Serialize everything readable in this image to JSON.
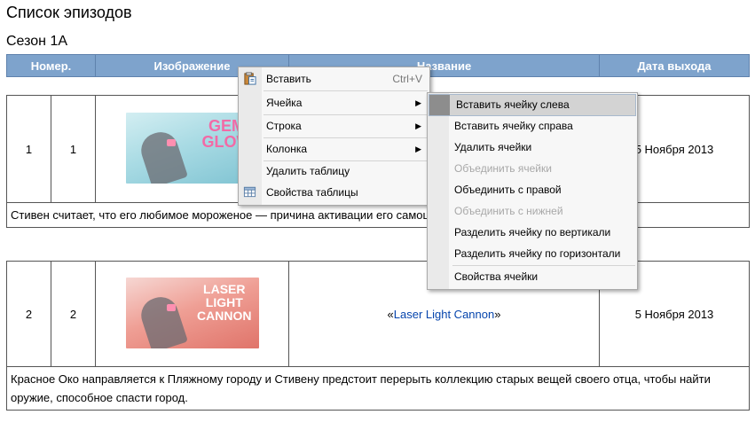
{
  "page": {
    "title": "Список эпизодов",
    "season": "Сезон 1А"
  },
  "table_header": {
    "columns": [
      "Номер.",
      "Изображение",
      "Название",
      "Дата выхода"
    ]
  },
  "episodes": [
    {
      "num_overall": "1",
      "num_season": "1",
      "thumb_title": "GEM GLOW",
      "date": "5 Ноября 2013",
      "description": "Стивен считает, что его любимое мороженое — причина активации его самоц"
    },
    {
      "num_overall": "2",
      "num_season": "2",
      "thumb_title": "LASER LIGHT CANNON",
      "title_prefix": "«",
      "title_link": "Laser Light Cannon",
      "title_suffix": "»",
      "date": "5 Ноября 2013",
      "description": "Красное Око направляется к Пляжному городу и Стивену предстоит перерыть коллекцию старых вещей своего отца, чтобы найти оружие, способное спасти город."
    }
  ],
  "context_menu": {
    "items": [
      {
        "label": "Вставить",
        "shortcut": "Ctrl+V",
        "icon": "paste-icon"
      },
      {
        "label": "Ячейка",
        "submenu": true
      },
      {
        "label": "Строка",
        "submenu": true
      },
      {
        "label": "Колонка",
        "submenu": true
      },
      {
        "label": "Удалить таблицу"
      },
      {
        "label": "Свойства таблицы",
        "icon": "table-properties-icon"
      }
    ],
    "submenu_arrow": "▶"
  },
  "cell_submenu": {
    "items": [
      {
        "label": "Вставить ячейку слева",
        "highlighted": true
      },
      {
        "label": "Вставить ячейку справа"
      },
      {
        "label": "Удалить ячейки"
      },
      {
        "label": "Объединить ячейки",
        "disabled": true
      },
      {
        "label": "Объединить с правой"
      },
      {
        "label": "Объединить с нижней",
        "disabled": true
      },
      {
        "label": "Разделить ячейку по вертикали"
      },
      {
        "label": "Разделить ячейку по горизонтали"
      },
      {
        "label": "Свойства ячейки"
      }
    ]
  },
  "colors": {
    "header_bg": "#7ea3cc",
    "link": "#0645ad",
    "menu_bg": "#f7f7f7"
  }
}
